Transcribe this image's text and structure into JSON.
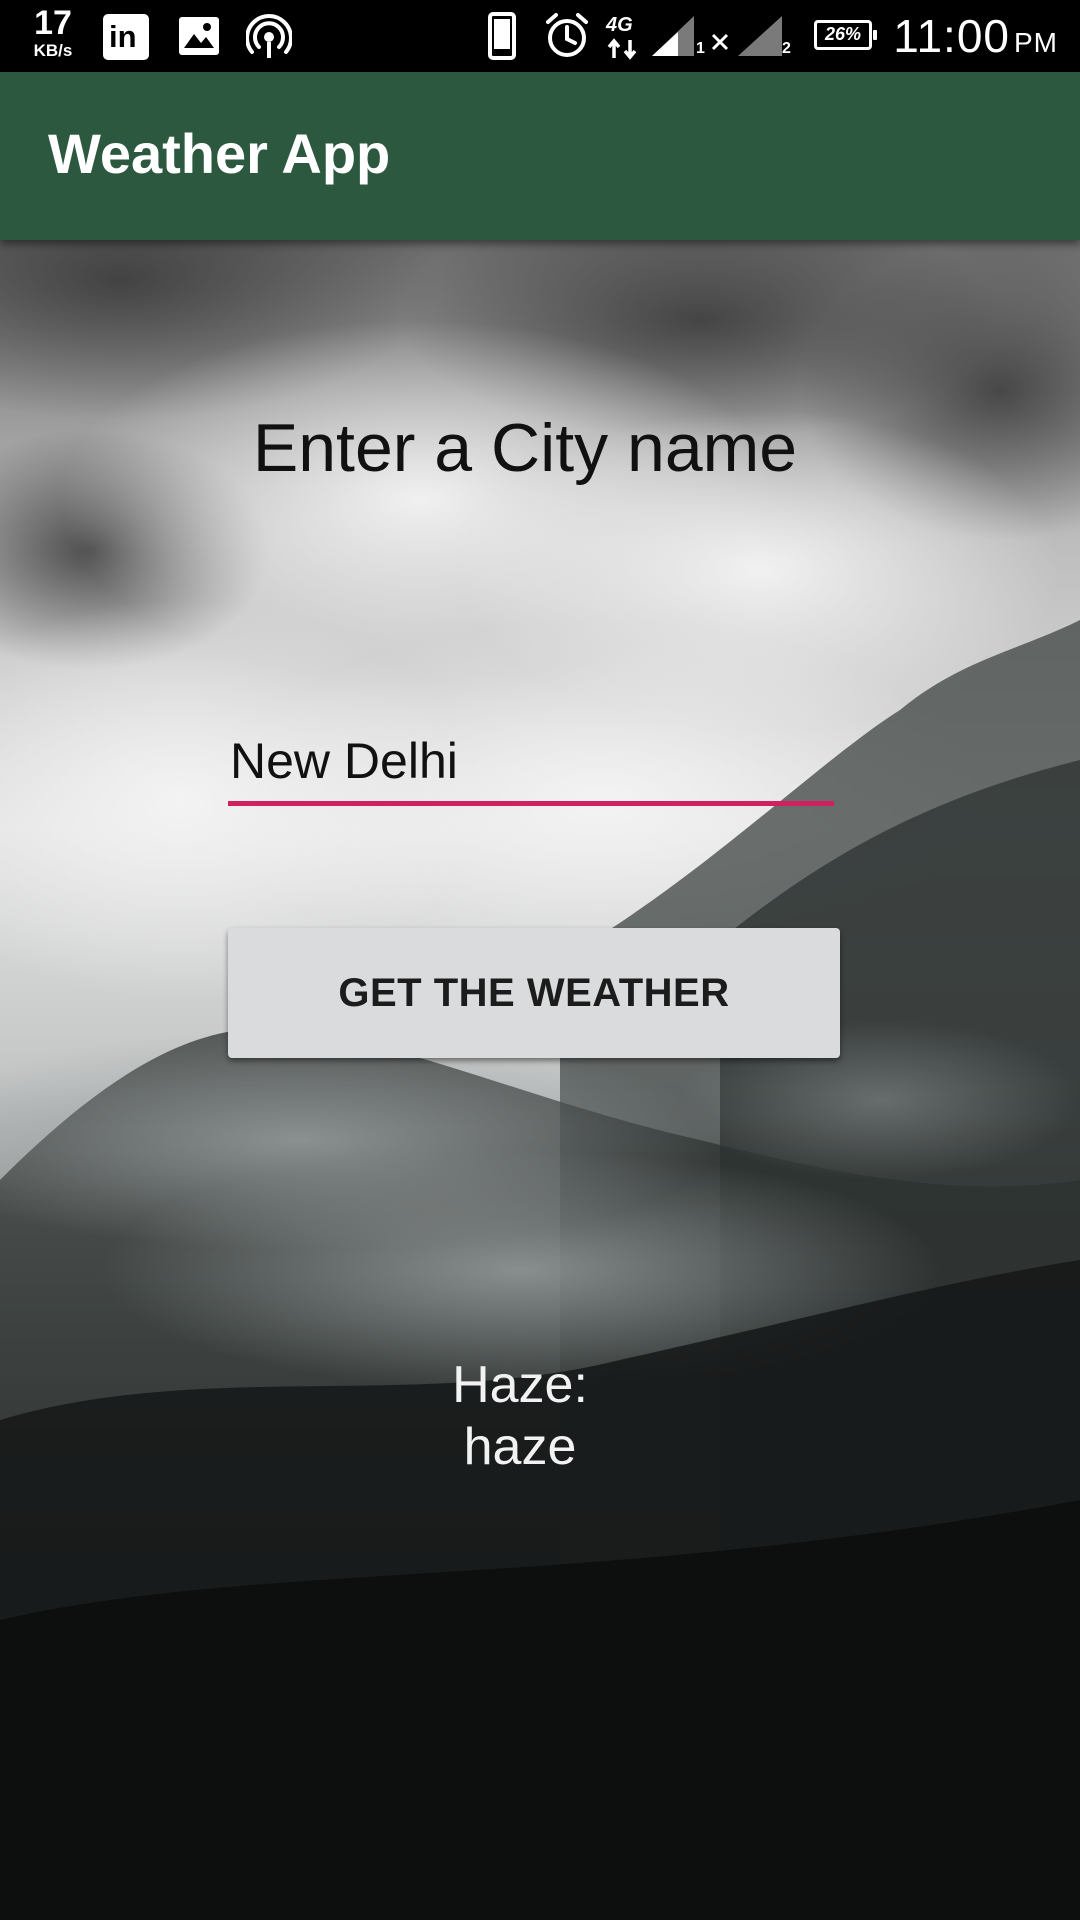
{
  "status_bar": {
    "speed_value": "17",
    "speed_unit": "KB/s",
    "linkedin_glyph": "in",
    "network_label": "4G",
    "sim1_label": "1",
    "sim2_label": "2",
    "battery_percent": "26%",
    "time": "11:00",
    "ampm": "PM",
    "icons": [
      "linkedin-icon",
      "image-icon",
      "hotspot-icon",
      "phone-icon",
      "alarm-icon",
      "4g-data-icon",
      "signal-icon",
      "battery-icon"
    ]
  },
  "app_bar": {
    "title": "Weather App",
    "color": "#2d5840"
  },
  "main": {
    "heading": "Enter a City name",
    "city_input": {
      "value": "New Delhi",
      "underline_color": "#d0205e"
    },
    "get_weather_button": {
      "label": "GET THE WEATHER"
    },
    "result": {
      "line1": "Haze:",
      "line2": "haze"
    }
  }
}
